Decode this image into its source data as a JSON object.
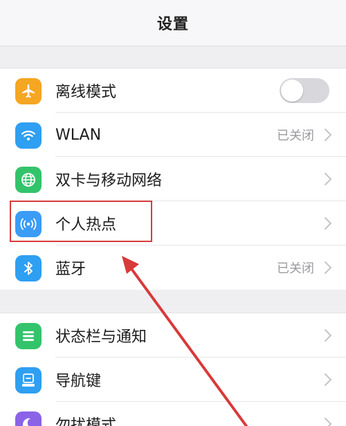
{
  "header": {
    "title": "设置"
  },
  "group1": [
    {
      "label": "离线模式",
      "icon": "airplane-icon",
      "control": "toggle",
      "toggle_on": false,
      "icon_color": "#f5a623"
    },
    {
      "label": "WLAN",
      "icon": "wifi-icon",
      "status": "已关闭",
      "icon_color": "#2f9ff2"
    },
    {
      "label": "双卡与移动网络",
      "icon": "globe-icon",
      "icon_color": "#33c46b"
    },
    {
      "label": "个人热点",
      "icon": "hotspot-icon",
      "icon_color": "#3a9cf5"
    },
    {
      "label": "蓝牙",
      "icon": "bluetooth-icon",
      "status": "已关闭",
      "icon_color": "#2f9ff2"
    }
  ],
  "group2": [
    {
      "label": "状态栏与通知",
      "icon": "notification-list-icon",
      "icon_color": "#33c46b"
    },
    {
      "label": "导航键",
      "icon": "navigation-key-icon",
      "icon_color": "#2f9ff2"
    },
    {
      "label": "勿扰模式",
      "icon": "moon-icon",
      "icon_color": "#8b63e8"
    }
  ],
  "annotation": {
    "highlight_target": "个人热点",
    "color": "#d83a3a"
  }
}
